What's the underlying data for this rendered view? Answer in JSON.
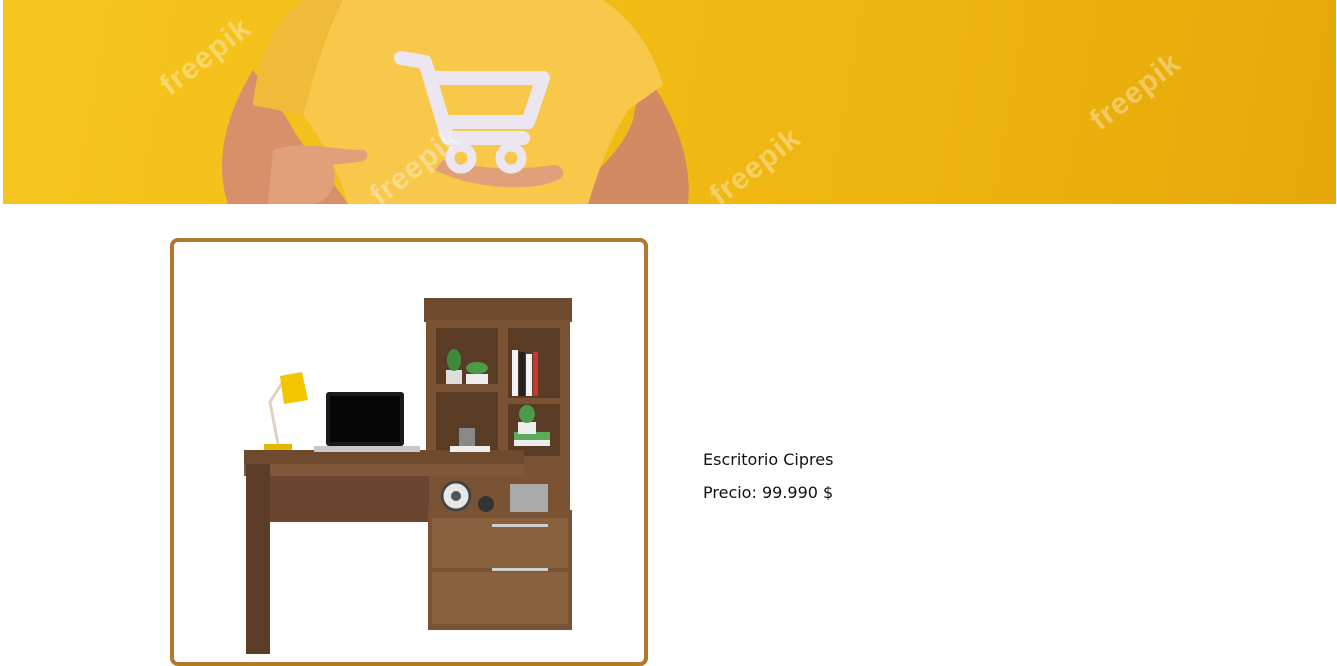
{
  "hero": {
    "watermark_text": "freepik",
    "colors": {
      "background": "#f3bd16",
      "shirt": "#f7c84a",
      "skin": "#d9906a",
      "cart": "#ece6f0"
    },
    "icon": "shopping-cart-icon"
  },
  "product": {
    "name": "Escritorio Cipres",
    "price_label": "Precio:",
    "price_value": "99.990 $",
    "card_border_color": "#b5762e",
    "image": "wooden-desk-with-bookshelf-image"
  }
}
